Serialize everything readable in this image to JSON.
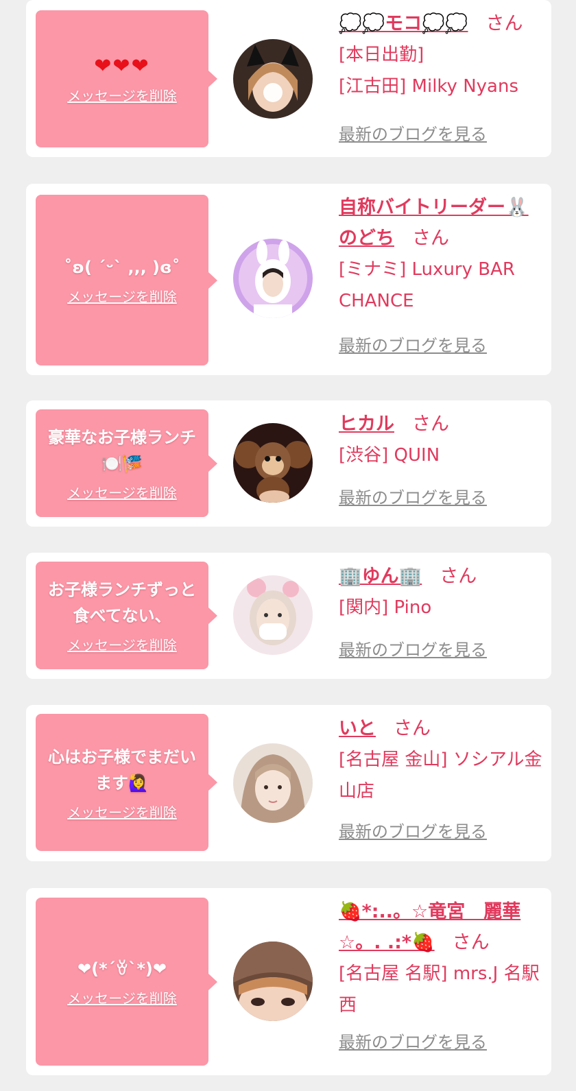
{
  "common": {
    "delete_label": "メッセージを削除",
    "san_label": "さん",
    "blog_label": "最新のブログを見る"
  },
  "cards": [
    {
      "message": "❤❤❤",
      "name": "💭💭モコ💭💭",
      "shop": "[本日出勤]\n[江古田] Milky Nyans",
      "avatar_colors": [
        "#3a2a24",
        "#f3d9c8"
      ]
    },
    {
      "message": "˚ʚ( ˊᵕˋ ,,, )ɞ˚",
      "name": "自称バイトリーダー🐰のどち",
      "shop": "[ミナミ] Luxury BAR CHANCE",
      "avatar_colors": [
        "#c79ce8",
        "#f4ecf6"
      ]
    },
    {
      "message": "豪華なお子様ランチ🍽️🎏",
      "name": "ヒカル",
      "shop": "[渋谷] QUIN",
      "avatar_colors": [
        "#2b1512",
        "#8a5a3a"
      ]
    },
    {
      "message": "お子様ランチずっと食べてない、",
      "name": "🏢ゆん🏢",
      "shop": "[関内] Pino",
      "avatar_colors": [
        "#f5d7df",
        "#e8e4e0"
      ]
    },
    {
      "message": "心はお子様でまだいます🙋‍♀️",
      "name": "いと",
      "shop": "[名古屋 金山] ソシアル金山店",
      "avatar_colors": [
        "#d6c6b8",
        "#5a4a40"
      ]
    },
    {
      "message": "❤(*´ꈊ`*)❤",
      "name": "🍓*:..。☆竜宮　麗華☆。. .:*🍓",
      "shop": "[名古屋 名駅] mrs.J 名駅西",
      "avatar_colors": [
        "#7a5a48",
        "#e9cdb9"
      ]
    }
  ]
}
